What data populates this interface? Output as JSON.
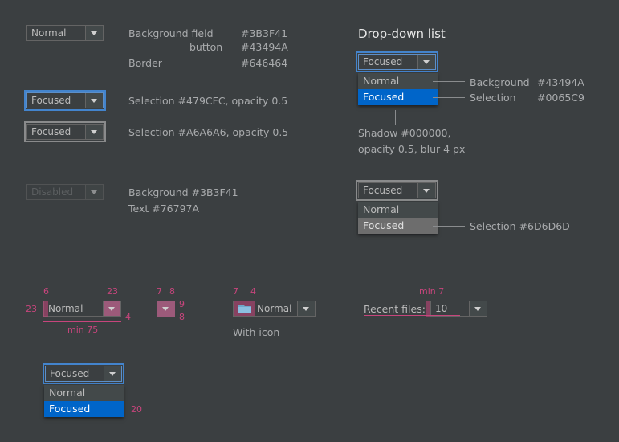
{
  "combos": {
    "normal": "Normal",
    "focused_blue": "Focused",
    "focused_gray": "Focused",
    "disabled": "Disabled"
  },
  "notes": {
    "bg_field": "Background field",
    "bg_field_hex": "#3B3F41",
    "button": "button",
    "button_hex": "#43494A",
    "border": "Border",
    "border_hex": "#646464",
    "selection_blue": "Selection #479CFC, opacity 0.5",
    "selection_gray": "Selection #A6A6A6, opacity 0.5",
    "disabled_bg": "Background #3B3F41",
    "disabled_text": "Text #76797A"
  },
  "dropdown": {
    "title": "Drop-down list",
    "field1": "Focused",
    "items1": [
      "Normal",
      "Focused"
    ],
    "bg_label": "Background",
    "bg_hex": "#43494A",
    "sel_label": "Selection",
    "sel_hex": "#0065C9",
    "shadow1": "Shadow #000000,",
    "shadow2": "opacity 0.5, blur 4 px",
    "field2": "Focused",
    "items2": [
      "Normal",
      "Focused"
    ],
    "sel2": "Selection #6D6D6D"
  },
  "metrics": {
    "m6": "6",
    "m23": "23",
    "m23v": "23",
    "m4": "4",
    "min75": "min 75",
    "combo": "Normal",
    "m7": "7",
    "m8": "8",
    "m9": "9",
    "m8b": "8",
    "m7b": "7",
    "m4b": "4",
    "icon_combo": "Normal",
    "with_icon": "With icon",
    "min7": "min 7",
    "recent_label": "Recent files:",
    "recent_value": "10",
    "bottom_field": "Focused",
    "bottom_items": [
      "Normal",
      "Focused"
    ],
    "m20": "20"
  },
  "colors": {
    "background": "#3B3F41",
    "button": "#43494A",
    "border": "#646464",
    "focus_blue": "#479CFC",
    "focus_gray": "#A6A6A6",
    "list_bg": "#43494A",
    "selection_blue": "#0065C9",
    "selection_gray": "#6D6D6D",
    "annotation": "#C7457C"
  }
}
